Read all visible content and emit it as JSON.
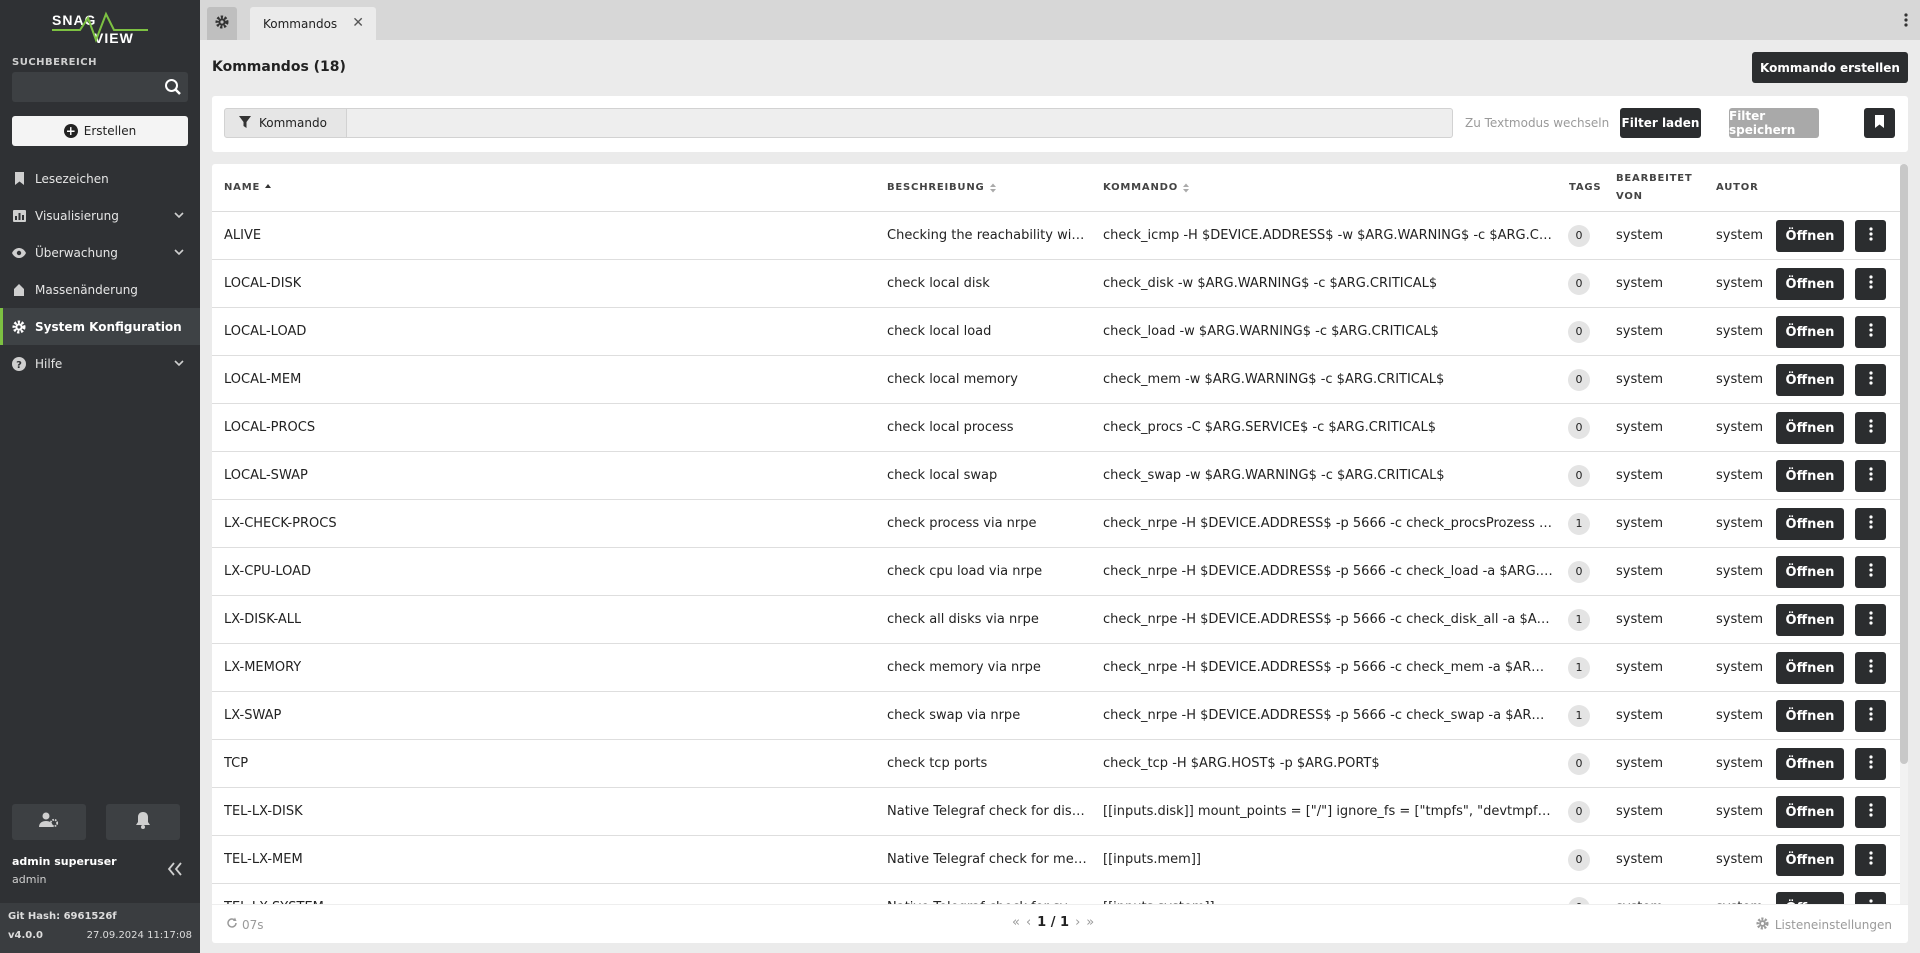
{
  "sidebar": {
    "logo_text": "SNAG VIEW",
    "search_label": "SUCHBEREICH",
    "search_value": "",
    "create_label": "Erstellen",
    "nav": [
      {
        "label": "Lesezeichen",
        "icon": "bookmark-icon",
        "has_children": false,
        "active": false
      },
      {
        "label": "Visualisierung",
        "icon": "chart-icon",
        "has_children": true,
        "active": false
      },
      {
        "label": "Überwachung",
        "icon": "eye-icon",
        "has_children": true,
        "active": false
      },
      {
        "label": "Massenänderung",
        "icon": "stack-icon",
        "has_children": false,
        "active": false
      },
      {
        "label": "System Konfiguration",
        "icon": "gear-icon",
        "has_children": false,
        "active": true
      },
      {
        "label": "Hilfe",
        "icon": "help-icon",
        "has_children": true,
        "active": false
      }
    ],
    "user_name": "admin superuser",
    "user_role": "admin",
    "git_hash": "Git Hash: 6961526f",
    "version": "v4.0.0",
    "build_date": "27.09.2024 11:17:08"
  },
  "tabs": [
    {
      "label": "Kommandos"
    }
  ],
  "page": {
    "title": "Kommandos (18)",
    "create_button": "Kommando erstellen"
  },
  "filter": {
    "chip_label": "Kommando",
    "input_value": "",
    "textmode_label": "Zu Textmodus wechseln",
    "load_label": "Filter laden",
    "save_label": "Filter speichern"
  },
  "table": {
    "columns": [
      "NAME",
      "BESCHREIBUNG",
      "KOMMANDO",
      "TAGS",
      "BEARBEITET VON",
      "AUTOR"
    ],
    "open_label": "Öffnen",
    "rows": [
      {
        "name": "ALIVE",
        "description": "Checking the reachability with ICMP",
        "command": "check_icmp -H $DEVICE.ADDRESS$ -w $ARG.WARNING$ -c $ARG.CRITICAL$",
        "tags": "0",
        "edited_by": "system",
        "author": "system"
      },
      {
        "name": "LOCAL-DISK",
        "description": "check local disk",
        "command": "check_disk -w $ARG.WARNING$ -c $ARG.CRITICAL$",
        "tags": "0",
        "edited_by": "system",
        "author": "system"
      },
      {
        "name": "LOCAL-LOAD",
        "description": "check local load",
        "command": "check_load -w $ARG.WARNING$ -c $ARG.CRITICAL$",
        "tags": "0",
        "edited_by": "system",
        "author": "system"
      },
      {
        "name": "LOCAL-MEM",
        "description": "check local memory",
        "command": "check_mem -w $ARG.WARNING$ -c $ARG.CRITICAL$",
        "tags": "0",
        "edited_by": "system",
        "author": "system"
      },
      {
        "name": "LOCAL-PROCS",
        "description": "check local process",
        "command": "check_procs -C $ARG.SERVICE$ -c $ARG.CRITICAL$",
        "tags": "0",
        "edited_by": "system",
        "author": "system"
      },
      {
        "name": "LOCAL-SWAP",
        "description": "check local swap",
        "command": "check_swap -w $ARG.WARNING$ -c $ARG.CRITICAL$",
        "tags": "0",
        "edited_by": "system",
        "author": "system"
      },
      {
        "name": "LX-CHECK-PROCS",
        "description": "check process via nrpe",
        "command": "check_nrpe -H $DEVICE.ADDRESS$ -p 5666 -c check_procsProzess -a $ARG.SERVICE$",
        "tags": "1",
        "edited_by": "system",
        "author": "system"
      },
      {
        "name": "LX-CPU-LOAD",
        "description": "check cpu load via nrpe",
        "command": "check_nrpe -H $DEVICE.ADDRESS$ -p 5666 -c check_load -a $ARG.WARNING$",
        "tags": "0",
        "edited_by": "system",
        "author": "system"
      },
      {
        "name": "LX-DISK-ALL",
        "description": "check all disks via nrpe",
        "command": "check_nrpe -H $DEVICE.ADDRESS$ -p 5666 -c check_disk_all -a $ARG.WARNING$",
        "tags": "1",
        "edited_by": "system",
        "author": "system"
      },
      {
        "name": "LX-MEMORY",
        "description": "check memory via nrpe",
        "command": "check_nrpe -H $DEVICE.ADDRESS$ -p 5666 -c check_mem -a $ARG.WARNING$",
        "tags": "1",
        "edited_by": "system",
        "author": "system"
      },
      {
        "name": "LX-SWAP",
        "description": "check swap via nrpe",
        "command": "check_nrpe -H $DEVICE.ADDRESS$ -p 5666 -c check_swap -a $ARG.WARNING$",
        "tags": "1",
        "edited_by": "system",
        "author": "system"
      },
      {
        "name": "TCP",
        "description": "check tcp ports",
        "command": "check_tcp -H $ARG.HOST$ -p $ARG.PORT$",
        "tags": "0",
        "edited_by": "system",
        "author": "system"
      },
      {
        "name": "TEL-LX-DISK",
        "description": "Native Telegraf check for disk in Linux",
        "command": "[[inputs.disk]] mount_points = [\"/\"] ignore_fs = [\"tmpfs\", \"devtmpfs\", \"devfs\"]",
        "tags": "0",
        "edited_by": "system",
        "author": "system"
      },
      {
        "name": "TEL-LX-MEM",
        "description": "Native Telegraf check for memory in Linux",
        "command": "[[inputs.mem]]",
        "tags": "0",
        "edited_by": "system",
        "author": "system"
      },
      {
        "name": "TEL-LX-SYSTEM",
        "description": "Native Telegraf check for system in Linux",
        "command": "[[inputs.system]]",
        "tags": "0",
        "edited_by": "system",
        "author": "system"
      }
    ]
  },
  "footer": {
    "refresh_label": "07s",
    "page_label": "1 / 1",
    "list_settings_label": "Listeneinstellungen"
  },
  "colors": {
    "sidebar_bg": "#2f3134",
    "accent": "#7dc142",
    "button_dark": "#2b2d2f"
  }
}
